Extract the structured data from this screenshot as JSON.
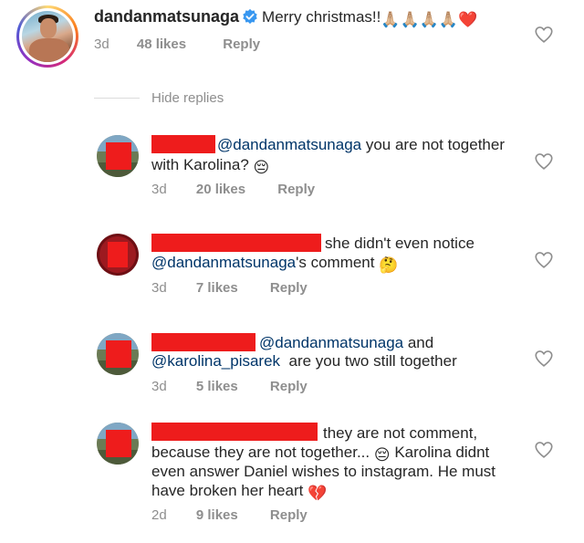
{
  "main_comment": {
    "username": "dandanmatsunaga",
    "text": "Merry christmas!!",
    "emoji_tail": "🙏🏼🙏🏼🙏🏼🙏🏼❤️",
    "time": "3d",
    "likes": "48 likes",
    "reply": "Reply"
  },
  "hide_replies": "Hide replies",
  "replies": [
    {
      "line1_mention": "@dandanmatsunaga",
      "line1_text": " you are not together",
      "line2_text": "with Karolina?",
      "line2_emoji": "😔",
      "time": "3d",
      "likes": "20 likes",
      "reply": "Reply"
    },
    {
      "line1_text": "she didn't even notice",
      "line2_mention": "@dandanmatsunaga",
      "line2_text": "'s comment",
      "line2_emoji": "🤔",
      "time": "3d",
      "likes": "7 likes",
      "reply": "Reply"
    },
    {
      "line1_mention": "@dandanmatsunaga",
      "line1_text": " and",
      "line2_mention": "@karolina_pisarek",
      "line2_text": "  are you two still together",
      "time": "3d",
      "likes": "5 likes",
      "reply": "Reply"
    },
    {
      "line1_text": "they are not comment,",
      "line2_text": "because they are not together...",
      "line2_emoji": "😔",
      "line2_text_b": " Karolina didnt",
      "line3_text": "even answer Daniel wishes to instagram. He must",
      "line4_text": "have broken her heart",
      "line4_emoji": "💔",
      "time": "2d",
      "likes": "9 likes",
      "reply": "Reply"
    }
  ],
  "colors": {
    "redaction": "#ee1c1c",
    "mention": "#003569",
    "meta": "#8e8e8e",
    "verified": "#3897f0"
  }
}
